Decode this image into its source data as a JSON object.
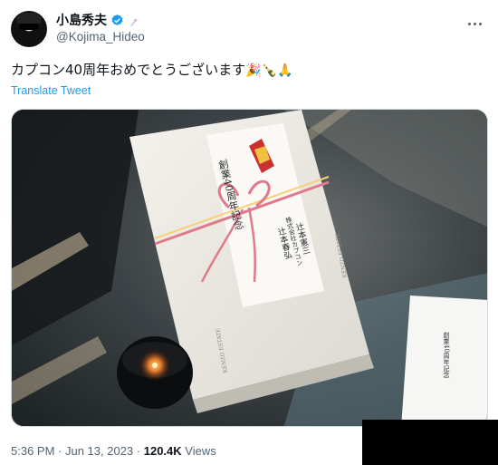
{
  "author": {
    "display_name": "小島秀夫",
    "handle": "@Kojima_Hideo"
  },
  "tweet": {
    "text": "カプコン40周年おめでとうございます",
    "emojis": "🎉🍾🙏",
    "translate_label": "Translate Tweet"
  },
  "meta": {
    "time": "5:36 PM",
    "separator1": " · ",
    "date": "Jun 13, 2023",
    "separator2": " · ",
    "views_count": "120.4K",
    "views_label": " Views"
  },
  "media": {
    "box_label_vertical": "創業40周年記念",
    "side_text_1": "KENZO ESTATE",
    "side_text_2": "KENZO ESTATE",
    "card_text": "創業40周年記念",
    "sender_line1": "株式会社カプコン",
    "sender_line2": "辻本憲三",
    "sender_line3": "辻本春弘"
  },
  "colors": {
    "link": "#1d9bf0",
    "secondary_text": "#536471",
    "verified": "#1d9bf0"
  }
}
